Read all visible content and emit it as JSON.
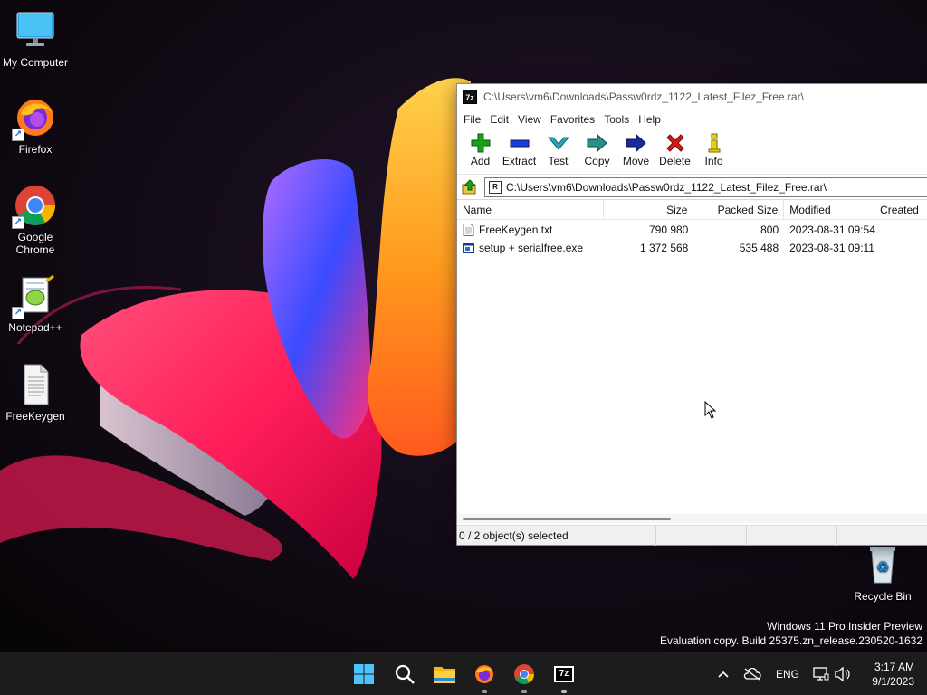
{
  "desktop": {
    "icons": [
      {
        "label": "My Computer"
      },
      {
        "label": "Firefox"
      },
      {
        "label": "Google Chrome"
      },
      {
        "label": "Notepad++"
      },
      {
        "label": "FreeKeygen"
      },
      {
        "label": "Recycle Bin"
      }
    ],
    "watermark": {
      "line1": "Windows 11 Pro Insider Preview",
      "line2": "Evaluation copy. Build 25375.zn_release.230520-1632"
    }
  },
  "window": {
    "app_icon": "7z",
    "title": "C:\\Users\\vm6\\Downloads\\Passw0rdz_1122_Latest_Filez_Free.rar\\",
    "menu": [
      "File",
      "Edit",
      "View",
      "Favorites",
      "Tools",
      "Help"
    ],
    "toolbar": [
      {
        "label": "Add",
        "icon": "plus-icon",
        "color": "#1aa31a"
      },
      {
        "label": "Extract",
        "icon": "minus-icon",
        "color": "#1a3fd6"
      },
      {
        "label": "Test",
        "icon": "check-icon",
        "color": "#2aa6b8"
      },
      {
        "label": "Copy",
        "icon": "double-arrow-icon",
        "color": "#2a8f88"
      },
      {
        "label": "Move",
        "icon": "arrow-right-icon",
        "color": "#1a2a9a"
      },
      {
        "label": "Delete",
        "icon": "x-icon",
        "color": "#d61a1a"
      },
      {
        "label": "Info",
        "icon": "info-icon",
        "color": "#b8a400"
      }
    ],
    "address": "C:\\Users\\vm6\\Downloads\\Passw0rdz_1122_Latest_Filez_Free.rar\\",
    "columns": [
      "Name",
      "Size",
      "Packed Size",
      "Modified",
      "Created"
    ],
    "files": [
      {
        "name": "FreeKeygen.txt",
        "size": "790 980",
        "packed": "800",
        "modified": "2023-08-31 09:54",
        "created": "",
        "icon": "text-file-icon"
      },
      {
        "name": "setup + serialfree.exe",
        "size": "1 372 568",
        "packed": "535 488",
        "modified": "2023-08-31 09:11",
        "created": "",
        "icon": "exe-file-icon"
      }
    ],
    "status": "0 / 2 object(s) selected"
  },
  "taskbar": {
    "apps": [
      "start-icon",
      "search-icon",
      "file-explorer-icon",
      "firefox-icon",
      "chrome-icon",
      "7zip-icon"
    ],
    "tray": {
      "language": "ENG"
    },
    "clock": {
      "time": "3:17 AM",
      "date": "9/1/2023"
    }
  },
  "colors": {
    "accent": "#0078d4",
    "taskbar": "#1c1c1c"
  }
}
